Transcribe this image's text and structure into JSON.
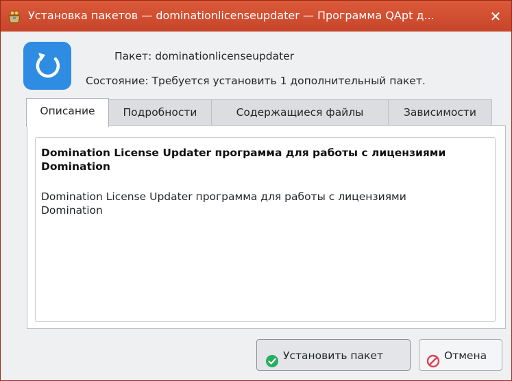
{
  "window": {
    "title": "Установка пакетов — dominationlicenseupdater — Программа QApt д...",
    "close_glyph": "✕",
    "title_icon": "package-installer-icon",
    "accent_color": "#c6452a"
  },
  "header": {
    "app_icon": "refresh-arrow-icon",
    "package_line": "Пакет: dominationlicenseupdater",
    "status_line": "Состояние: Требуется установить 1 дополнительный пакет."
  },
  "tabs": [
    {
      "label": "Описание",
      "active": true
    },
    {
      "label": "Подробности",
      "active": false
    },
    {
      "label": "Содержащиеся файлы",
      "active": false
    },
    {
      "label": "Зависимости",
      "active": false
    }
  ],
  "description": {
    "title": "Domination License Updater программа для работы с лицензиями Domination",
    "body": "Domination License Updater программа для работы с лицензиями Domination"
  },
  "buttons": {
    "install_label": "Установить пакет",
    "install_icon": "check-circle-icon",
    "cancel_label": "Отмена",
    "cancel_icon": "cancel-circle-icon"
  }
}
